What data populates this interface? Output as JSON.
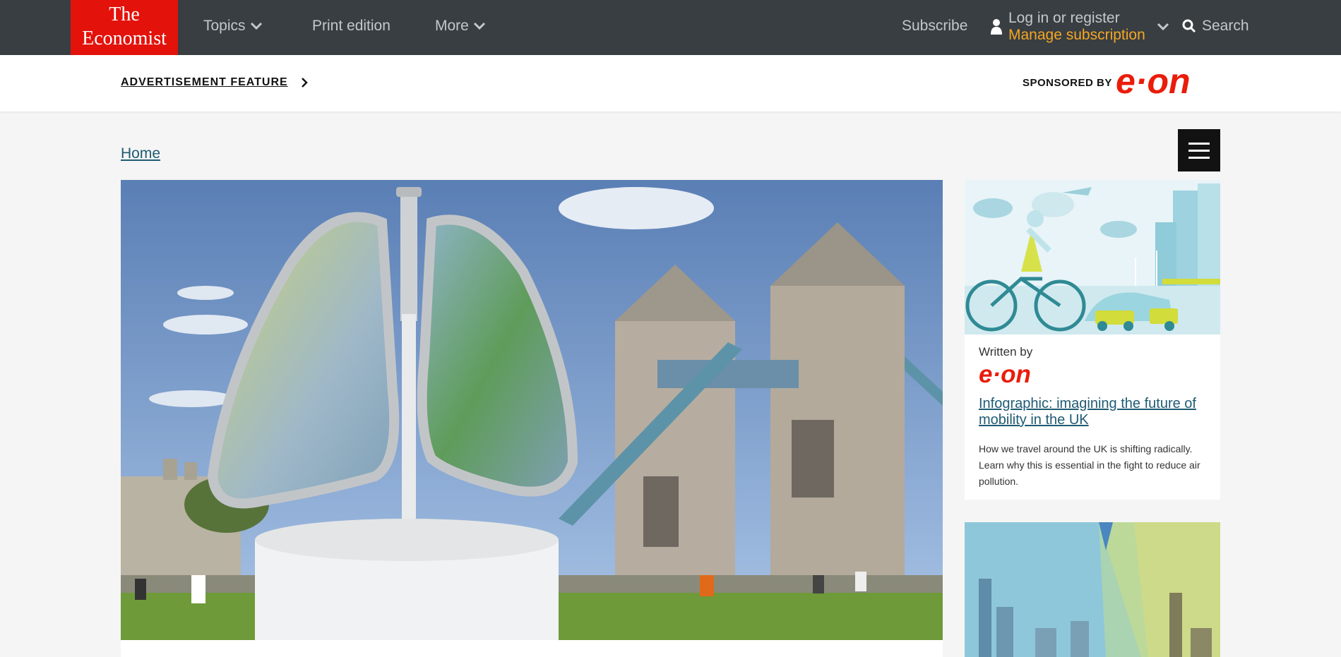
{
  "header": {
    "logo_line1": "The",
    "logo_line2": "Economist",
    "nav": {
      "topics": "Topics",
      "print_edition": "Print edition",
      "more": "More",
      "subscribe": "Subscribe"
    },
    "account": {
      "login": "Log in or register",
      "manage": "Manage subscription"
    },
    "search": "Search"
  },
  "sponsor_bar": {
    "feature_label": "ADVERTISEMENT FEATURE",
    "sponsored_by": "SPONSORED BY",
    "sponsor_logo_text": "e·on"
  },
  "breadcrumb": {
    "home": "Home"
  },
  "sidebar": {
    "card1": {
      "written_by": "Written by",
      "logo_text": "e·on",
      "title": "Infographic: imagining the future of mobility in the UK",
      "description": "How we travel around the UK is shifting radically. Learn why this is essential in the fight to reduce air pollution."
    }
  },
  "colors": {
    "nav_bg": "#383e42",
    "logo_red": "#e3120b",
    "accent_orange": "#f5a623",
    "link_blue": "#1f5b73",
    "eon_red": "#ea1c0a"
  },
  "icons": {
    "menu": "hamburger-icon",
    "search": "search-icon",
    "user": "user-icon",
    "chevron": "chevron-down-icon",
    "arrow": "chevron-right-icon"
  }
}
